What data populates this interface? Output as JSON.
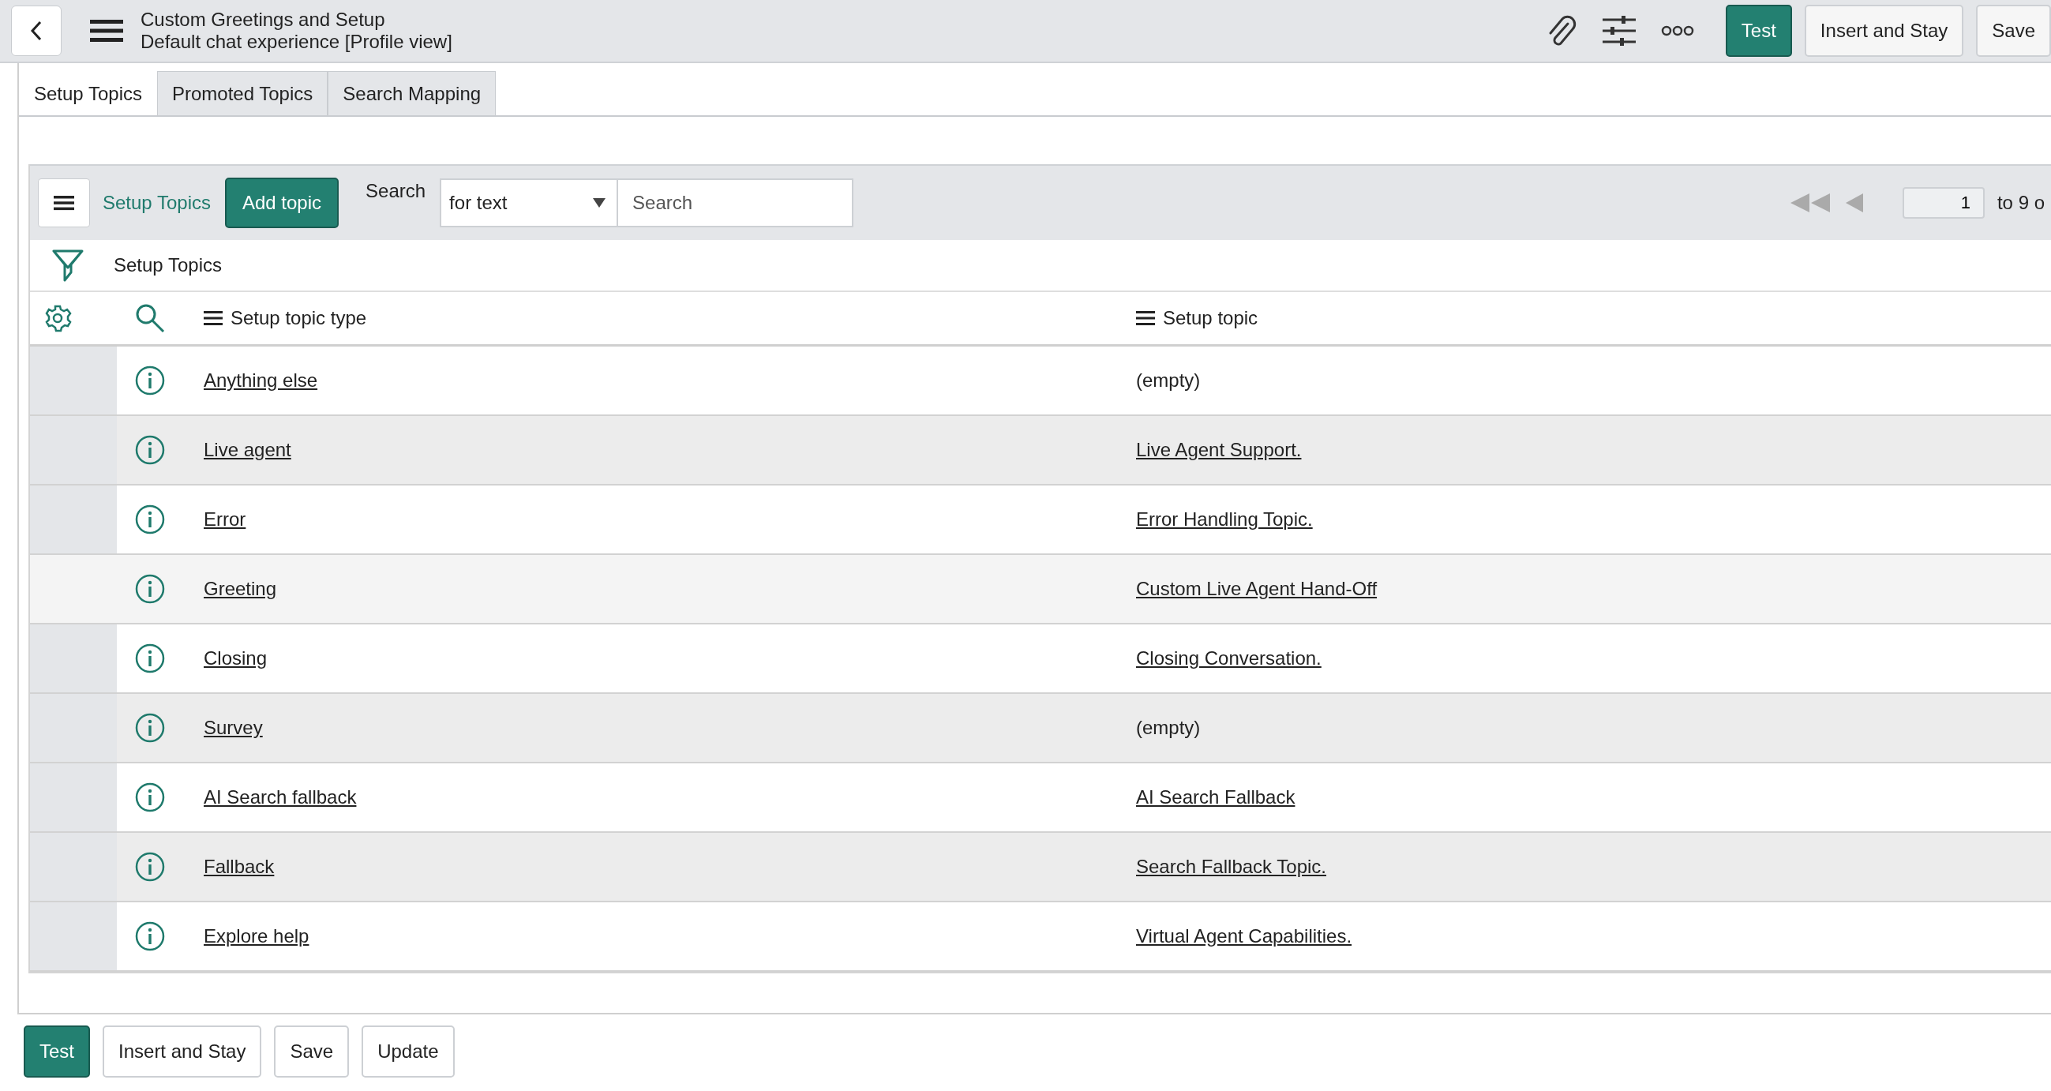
{
  "header": {
    "title": "Custom Greetings and Setup",
    "subtitle": "Default chat experience [Profile view]",
    "buttons": [
      {
        "label": "Test",
        "kind": "primary"
      },
      {
        "label": "Insert and Stay",
        "kind": "default"
      },
      {
        "label": "Save",
        "kind": "default"
      }
    ]
  },
  "tabs": [
    {
      "label": "Setup Topics",
      "selected": true
    },
    {
      "label": "Promoted Topics",
      "selected": false
    },
    {
      "label": "Search Mapping",
      "selected": false
    }
  ],
  "list_toolbar": {
    "title": "Setup Topics",
    "add_button": "Add topic",
    "search_label": "Search",
    "search_field_select": "for text",
    "search_placeholder": "Search",
    "page_value": "1",
    "page_total": "to 9 o"
  },
  "breadcrumb": "Setup Topics",
  "table": {
    "columns": [
      "Setup topic type",
      "Setup topic"
    ],
    "rows": [
      {
        "type": "Anything else",
        "topic": "(empty)",
        "topic_link": false,
        "selected": false
      },
      {
        "type": "Live agent",
        "topic": "Live Agent Support.",
        "topic_link": true,
        "selected": false
      },
      {
        "type": "Error",
        "topic": "Error Handling Topic.",
        "topic_link": true,
        "selected": false
      },
      {
        "type": "Greeting",
        "topic": "Custom Live Agent Hand-Off",
        "topic_link": true,
        "selected": true
      },
      {
        "type": "Closing",
        "topic": "Closing Conversation.",
        "topic_link": true,
        "selected": false
      },
      {
        "type": "Survey",
        "topic": "(empty)",
        "topic_link": false,
        "selected": false
      },
      {
        "type": "AI Search fallback",
        "topic": "AI Search Fallback",
        "topic_link": true,
        "selected": false
      },
      {
        "type": "Fallback",
        "topic": "Search Fallback Topic.",
        "topic_link": true,
        "selected": false
      },
      {
        "type": "Explore help",
        "topic": "Virtual Agent Capabilities.",
        "topic_link": true,
        "selected": false
      }
    ]
  },
  "footer_buttons": [
    {
      "label": "Test",
      "kind": "primary"
    },
    {
      "label": "Insert and Stay",
      "kind": "default"
    },
    {
      "label": "Save",
      "kind": "default"
    },
    {
      "label": "Update",
      "kind": "default"
    }
  ]
}
